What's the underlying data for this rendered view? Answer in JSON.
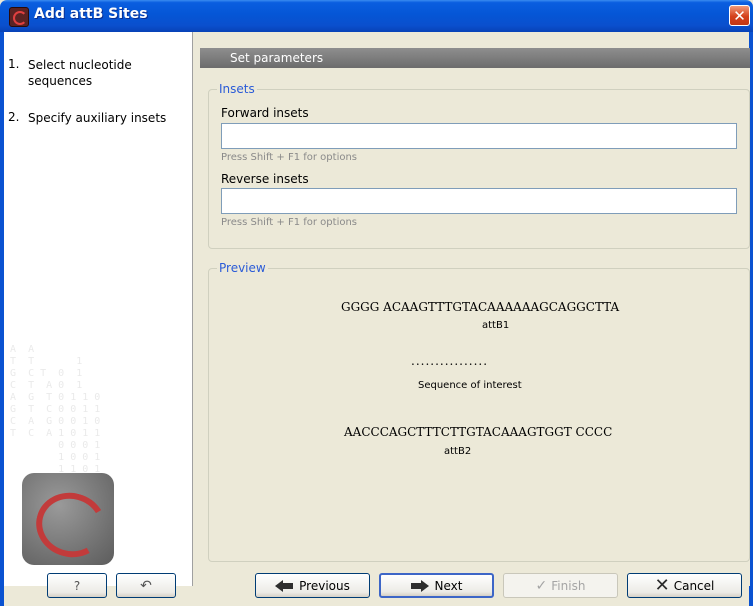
{
  "window": {
    "title": "Add attB Sites",
    "close_glyph": "✕"
  },
  "steps": [
    {
      "num": "1.",
      "label": "Select nucleotide sequences"
    },
    {
      "num": "2.",
      "label": "Specify auxiliary insets"
    }
  ],
  "panel": {
    "header": "Set parameters"
  },
  "insets": {
    "group_title": "Insets",
    "forward_label": "Forward insets",
    "forward_value": "",
    "forward_hint": "Press Shift + F1 for options",
    "reverse_label": "Reverse insets",
    "reverse_value": "",
    "reverse_hint": "Press Shift + F1 for options"
  },
  "preview": {
    "group_title": "Preview",
    "attb1_seq": "GGGG ACAAGTTTGTACAAAAAAGCAGGCTTA",
    "attb1_label": "attB1",
    "dots": "................",
    "interest_label": "Sequence of interest",
    "attb2_seq": "AACCCAGCTTTCTTGTACAAAGTGGT CCCC",
    "attb2_label": "attB2"
  },
  "buttons": {
    "help": "?",
    "reset_glyph": "↶",
    "previous": "Previous",
    "next": "Next",
    "finish": "Finish",
    "cancel": "Cancel"
  },
  "icons": {
    "help": "question-icon",
    "reset": "undo-icon",
    "previous": "arrow-left-icon",
    "next": "arrow-right-icon",
    "finish": "checkmark-icon",
    "cancel": "x-icon"
  },
  "colors": {
    "titlebar": "#0556d6",
    "group_title": "#2a5bd7",
    "dialog_bg": "#ece9d8"
  }
}
